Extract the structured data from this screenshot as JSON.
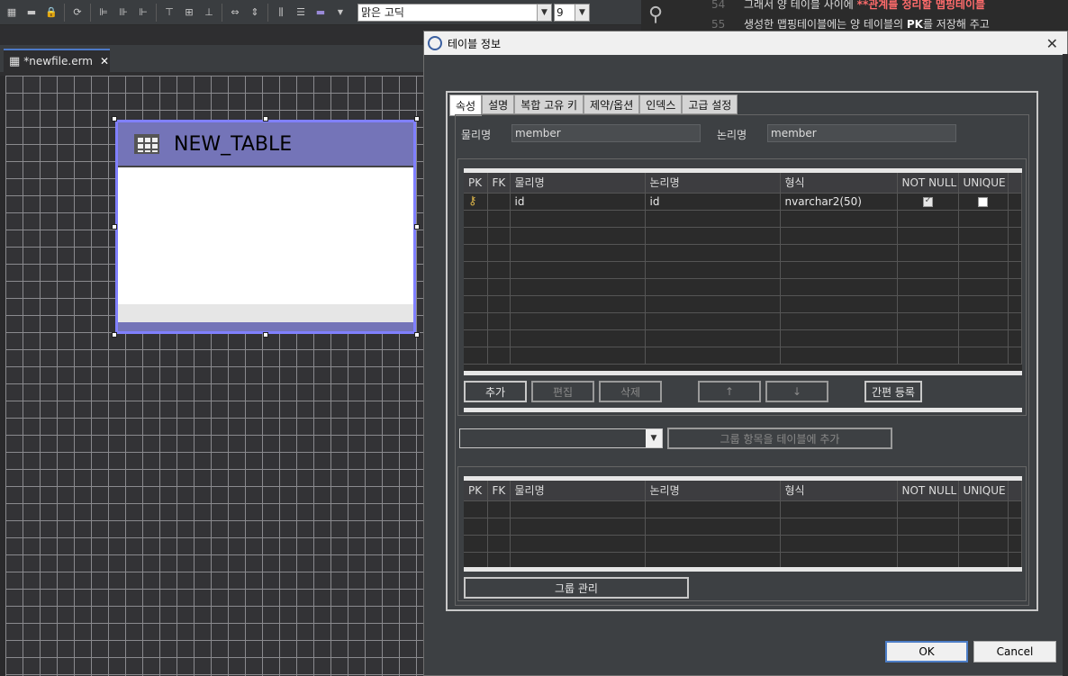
{
  "toolbar": {
    "font_name": "맑은 고딕",
    "font_size": "9"
  },
  "code": {
    "line1_no": "54",
    "line1_text_start": "그래서 양 테이블 사이에 ",
    "line1_highlight": "**관계를 정리할 맵핑테이블",
    "line2_no": "55",
    "line2_text_start": "생성한 맵핑테이블에는 양 테이블의 ",
    "line2_bold": "PK",
    "line2_text_end": "를 저장해 주고"
  },
  "editor": {
    "tab_label": "*newfile.erm",
    "tab_close": "✕"
  },
  "table_node": {
    "name": "NEW_TABLE"
  },
  "dialog": {
    "title": "테이블 정보",
    "close": "✕",
    "tabs": [
      "속성",
      "설명",
      "복합 고유 키",
      "제약/옵션",
      "인덱스",
      "고급 설정"
    ],
    "physical_label": "물리명",
    "physical_value": "member",
    "logical_label": "논리명",
    "logical_value": "member",
    "columns": [
      "PK",
      "FK",
      "물리명",
      "논리명",
      "형식",
      "NOT NULL",
      "UNIQUE"
    ],
    "rows": [
      {
        "pk": "🔑",
        "fk": "",
        "physical": "id",
        "logical": "id",
        "type": "nvarchar2(50)",
        "not_null": true,
        "unique": false
      }
    ],
    "buttons": {
      "add": "추가",
      "edit": "편집",
      "delete": "삭제",
      "up": "↑",
      "down": "↓",
      "quick_register": "간편 등록"
    },
    "group_combo_value": "",
    "add_group_button": "그룹 항목을 테이블에 추가",
    "group_manage_button": "그룹 관리",
    "ok": "OK",
    "cancel": "Cancel"
  }
}
